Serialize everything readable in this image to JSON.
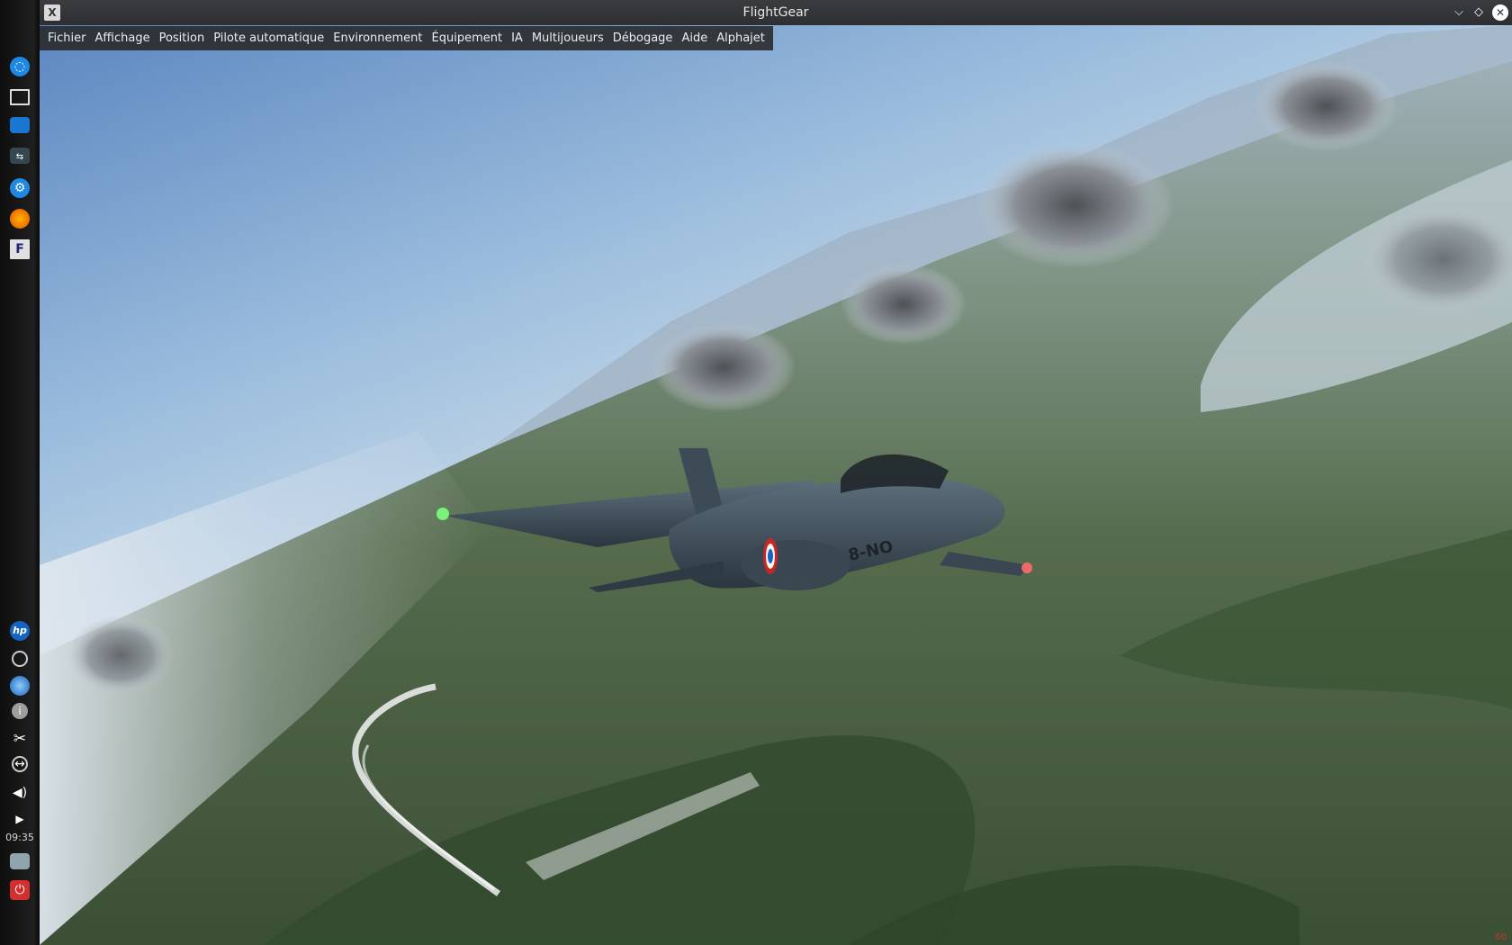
{
  "window": {
    "title": "FlightGear"
  },
  "menubar": {
    "items": [
      "Fichier",
      "Affichage",
      "Position",
      "Pilote automatique",
      "Environnement",
      "Équipement",
      "IA",
      "Multijoueurs",
      "Débogage",
      "Aide",
      "Alphajet"
    ]
  },
  "taskbar": {
    "clock": "09:35",
    "icons": [
      "kde-menu-icon",
      "desktop-icon",
      "folder-icon",
      "settings-panel-icon",
      "system-settings-icon",
      "firefox-icon",
      "flightgear-icon",
      "hp-icon",
      "update-icon",
      "network-globe-icon",
      "info-icon",
      "scissors-icon",
      "usb-icon",
      "volume-icon",
      "expand-tray-icon",
      "removable-drive-icon",
      "power-icon"
    ]
  },
  "scene": {
    "aircraft_marking": "8-NO",
    "fps_counter": "60"
  }
}
